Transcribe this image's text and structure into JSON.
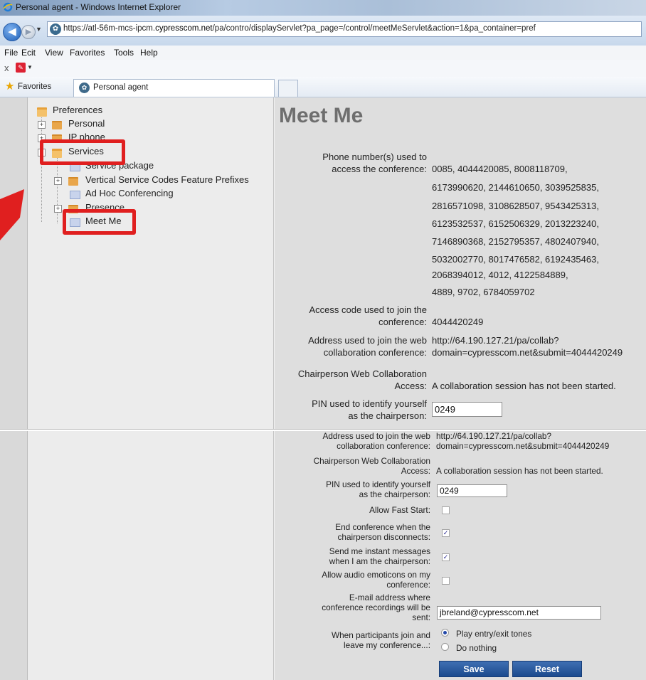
{
  "window": {
    "title": "Personal agent - Windows Internet Explorer"
  },
  "address": {
    "url_prefix": "https://atl-56m-mcs-ipcm.",
    "url_domain": "cypresscom.net",
    "url_rest": "/pa/contro/displayServlet?pa_page=/control/meetMeServlet&action=1&pa_container=pref"
  },
  "menu": [
    "File",
    "Ecit",
    "View",
    "Favorites",
    "Tools",
    "Help"
  ],
  "command_bar": {
    "stop_glyph": "x"
  },
  "favorites_bar": {
    "favorites_label": "Favorites",
    "tab_label": "Personal agent"
  },
  "tree": {
    "root": "Preferences",
    "personal": "Personal",
    "ip_phone": "IP phone",
    "services": "Services",
    "service_package": "Service package",
    "vsc": "Vertical Service Codes Feature Prefixes",
    "adhoc": "Ad Hoc Conferencing",
    "presence": "Presence",
    "meetme": "Meet Me"
  },
  "page": {
    "title": "Meet Me"
  },
  "form_top": {
    "phone_label": "Phone number(s) used to\naccess the conference:",
    "phone_lines": [
      "0085, 4044420085, 8008118709,",
      "6173990620, 2144610650, 3039525835,",
      "2816571098, 3108628507, 9543425313,",
      "6123532537, 6152506329, 2013223240,",
      "7146890368, 2152795357, 4802407940,",
      "5032002770, 8017476582, 6192435463,",
      "2068394012, 4012, 4122584889,",
      "4889, 9702, 6784059702"
    ],
    "access_code_label": "Access code used to join the\nconference:",
    "access_code": "4044420249",
    "web_addr_label": "Address used to join the web\ncollaboration conference:",
    "web_addr_line1": "http://64.190.127.21/pa/collab?",
    "web_addr_line2": "domain=cypresscom.net&submit=4044420249",
    "chair_label": "Chairperson Web Collaboration\nAccess:",
    "chair_value": "A collaboration session has not been started.",
    "pin_label": "PIN used to identify yourself\nas the chairperson:",
    "pin_value": "0249"
  },
  "form_bottom": {
    "web_addr_label": "Address used to join the web\ncollaboration conference:",
    "web_addr_line1": "http://64.190.127.21/pa/collab?",
    "web_addr_line2": "domain=cypresscom.net&submit=4044420249",
    "chair_label": "Chairperson Web Collaboration\nAccess:",
    "chair_value": "A collaboration session has not been started.",
    "pin_label": "PIN used to identify yourself\nas the chairperson:",
    "pin_value": "0249",
    "fast_start_label": "Allow Fast Start:",
    "fast_start_checked": false,
    "end_conf_label": "End conference when the\nchairperson disconnects:",
    "end_conf_checked": true,
    "im_label": "Send me instant messages\nwhen I am the chairperson:",
    "im_checked": true,
    "emoticons_label": "Allow audio emoticons on my\nconference:",
    "emoticons_checked": false,
    "email_label": "E-mail address where\nconference recordings will be\nsent:",
    "email_value": "jbreland@cypresscom.net",
    "join_label": "When participants join and\nleave my conference...:",
    "join_opt1": "Play entry/exit tones",
    "join_opt2": "Do nothing",
    "join_selected": "Play entry/exit tones",
    "save_label": "Save",
    "reset_label": "Reset"
  },
  "colors": {
    "highlight": "#e01f1f",
    "button": "#1f4f93",
    "title_gray": "#6e6e6e"
  }
}
